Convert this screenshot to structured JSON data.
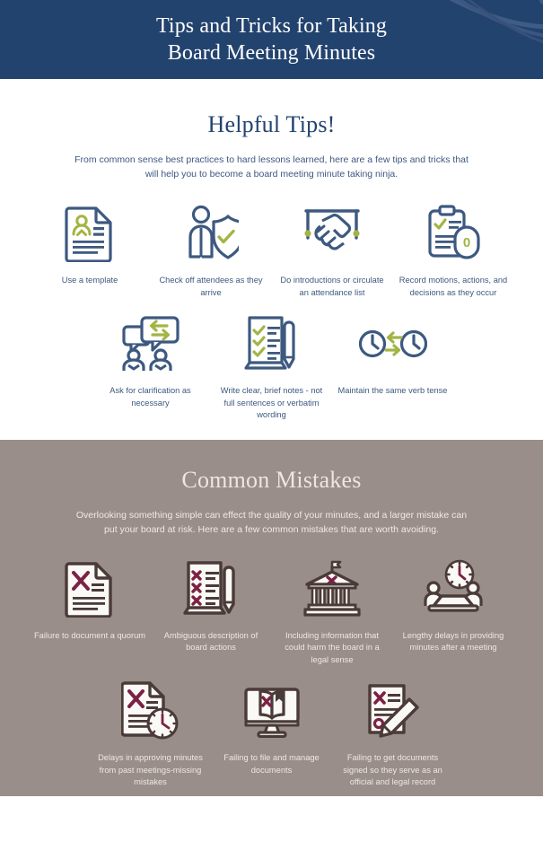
{
  "header": {
    "title_line1": "Tips and Tricks for Taking",
    "title_line2": "Board Meeting Minutes",
    "background_color": "#22436e",
    "text_color": "#ffffff",
    "decoration": "swoosh-decoration"
  },
  "theme": {
    "navy": "#3d5980",
    "navy_dark": "#22436e",
    "olive": "#a2b544",
    "taupe": "#998e89",
    "maroon": "#7b2244",
    "brown": "#4a3b38",
    "cream": "#fbf9f6"
  },
  "tips_section": {
    "heading": "Helpful Tips!",
    "intro": "From common sense best practices to hard lessons learned, here are a few tips and tricks that will help you to become a board meeting minute taking ninja.",
    "row1": [
      {
        "icon": "document-template-icon",
        "label": "Use a template"
      },
      {
        "icon": "person-shield-check-icon",
        "label": "Check off attendees as they arrive"
      },
      {
        "icon": "handshake-icon",
        "label": "Do introductions or circulate an attendance list"
      },
      {
        "icon": "clipboard-gavel-icon",
        "label": "Record motions, actions, and decisions as they occur"
      }
    ],
    "row2": [
      {
        "icon": "speech-bubbles-people-icon",
        "label": "Ask for clarification as necessary"
      },
      {
        "icon": "checklist-pen-icon",
        "label": "Write clear, brief notes - not full sentences or verbatim wording"
      },
      {
        "icon": "two-clocks-exchange-icon",
        "label": "Maintain the same verb tense"
      }
    ]
  },
  "mistakes_section": {
    "heading": "Common Mistakes",
    "intro": "Overlooking something simple can effect the quality of your minutes, and a larger mistake can put your board at risk. Here are a few common mistakes that are worth avoiding.",
    "row1": [
      {
        "icon": "document-x-icon",
        "label": "Failure to document a quorum"
      },
      {
        "icon": "checklist-x-pen-icon",
        "label": "Ambiguous description of board actions"
      },
      {
        "icon": "courthouse-x-icon",
        "label": "Including information that could harm the board in a legal sense"
      },
      {
        "icon": "meeting-table-clock-icon",
        "label": "Lengthy delays in providing minutes after a meeting"
      }
    ],
    "row2": [
      {
        "icon": "document-x-clock-icon",
        "label": "Delays in approving minutes from past meetings-missing mistakes"
      },
      {
        "icon": "monitor-book-x-icon",
        "label": "Failing to file and manage documents"
      },
      {
        "icon": "document-x-pencil-icon",
        "label": "Failing to get documents signed so they serve as an official and legal record"
      }
    ]
  }
}
